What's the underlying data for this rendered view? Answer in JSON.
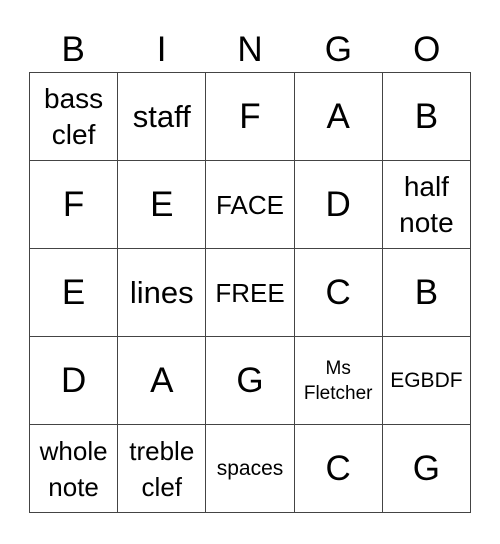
{
  "header": {
    "letters": [
      "B",
      "I",
      "N",
      "G",
      "O"
    ]
  },
  "grid": {
    "rows": [
      [
        "bass clef",
        "staff",
        "F",
        "A",
        "B"
      ],
      [
        "F",
        "E",
        "FACE",
        "D",
        "half note"
      ],
      [
        "E",
        "lines",
        "FREE",
        "C",
        "B"
      ],
      [
        "D",
        "A",
        "G",
        "Ms Fletcher",
        "EGBDF"
      ],
      [
        "whole note",
        "treble clef",
        "spaces",
        "C",
        "G"
      ]
    ]
  }
}
